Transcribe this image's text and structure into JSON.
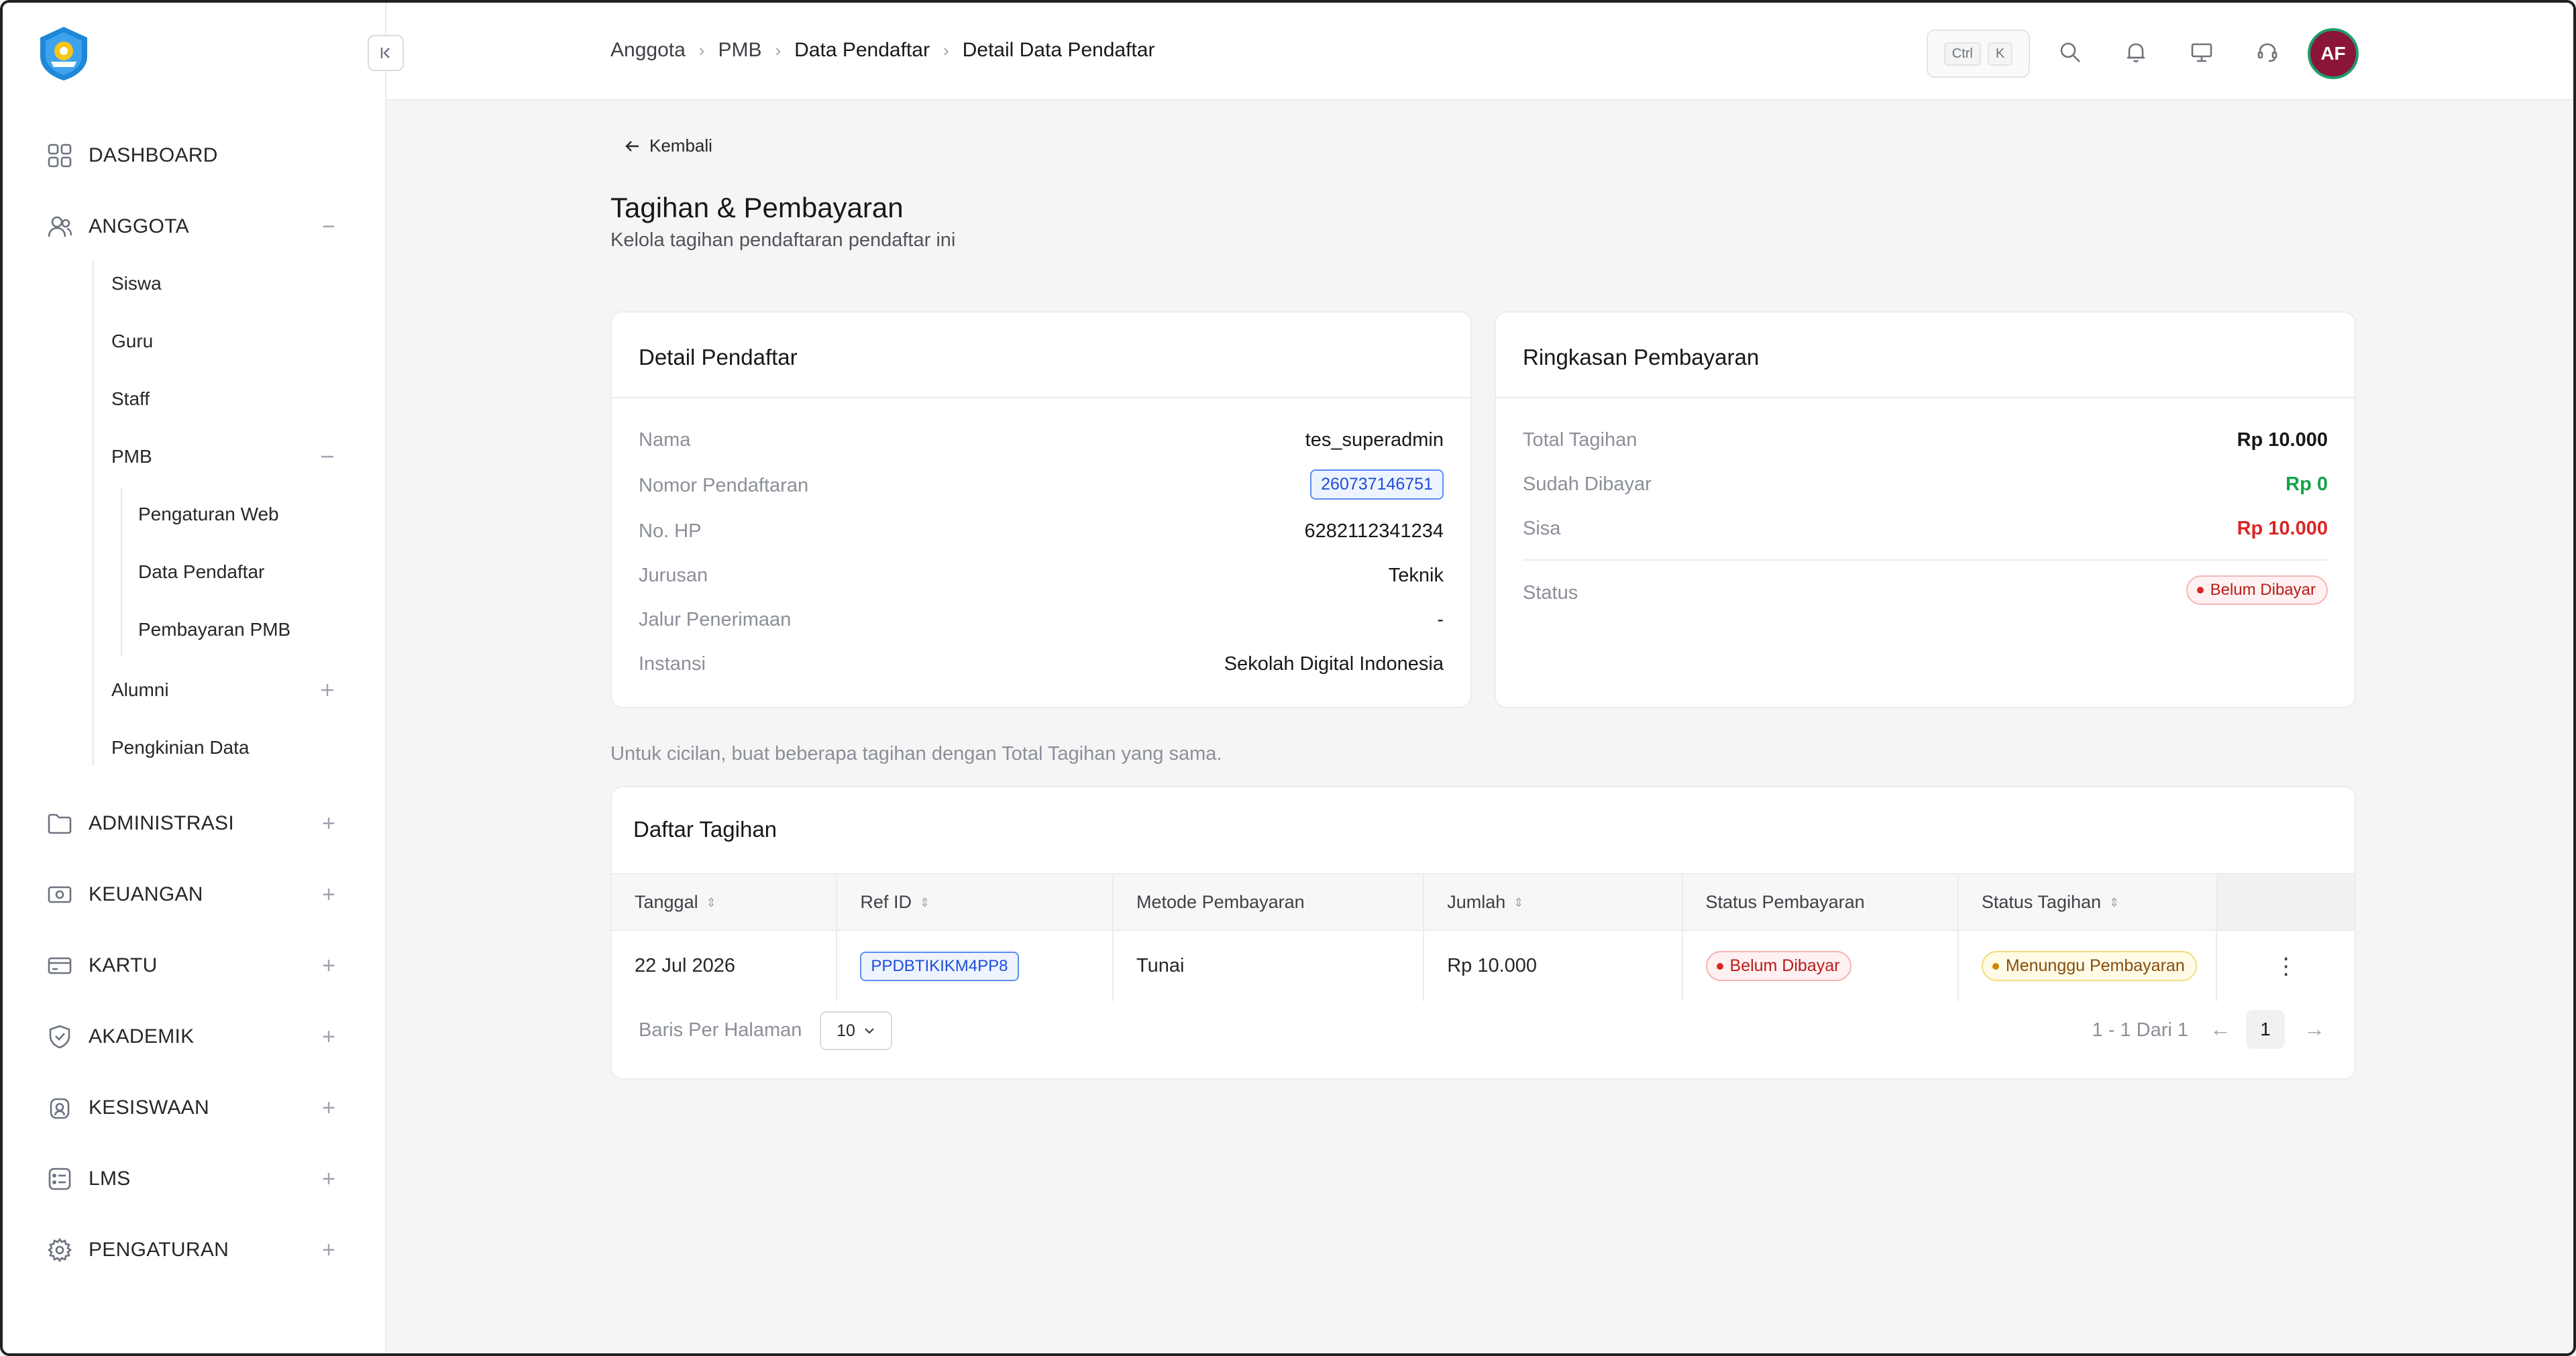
{
  "breadcrumb": [
    "Anggota",
    "PMB",
    "Data Pendaftar",
    "Detail Data Pendaftar"
  ],
  "search_kbd": {
    "ctrl": "Ctrl",
    "key": "K"
  },
  "user": {
    "initials": "AF",
    "avatar_color": "#8b1538"
  },
  "sidebar": {
    "items": [
      {
        "label": "DASHBOARD",
        "icon": "grid-icon"
      },
      {
        "label": "ANGGOTA",
        "icon": "users-icon",
        "toggle": "−"
      },
      {
        "label": "ADMINISTRASI",
        "icon": "folder-icon",
        "toggle": "+"
      },
      {
        "label": "KEUANGAN",
        "icon": "money-icon",
        "toggle": "+"
      },
      {
        "label": "KARTU",
        "icon": "card-icon",
        "toggle": "+"
      },
      {
        "label": "AKADEMIK",
        "icon": "shield-icon",
        "toggle": "+"
      },
      {
        "label": "KESISWAAN",
        "icon": "student-icon",
        "toggle": "+"
      },
      {
        "label": "LMS",
        "icon": "list-icon",
        "toggle": "+"
      },
      {
        "label": "PENGATURAN",
        "icon": "gear-icon",
        "toggle": "+"
      }
    ],
    "anggota_sub": [
      "Siswa",
      "Guru",
      "Staff",
      "PMB",
      "Alumni",
      "Pengkinian Data"
    ],
    "pmb_sub": [
      "Pengaturan Web",
      "Data Pendaftar",
      "Pembayaran PMB"
    ]
  },
  "page": {
    "back_label": "Kembali",
    "title": "Tagihan & Pembayaran",
    "subtitle": "Kelola tagihan pendaftaran pendaftar ini",
    "note": "Untuk cicilan, buat beberapa tagihan dengan Total Tagihan yang sama."
  },
  "detail": {
    "title": "Detail Pendaftar",
    "rows": [
      {
        "label": "Nama",
        "value": "tes_superadmin"
      },
      {
        "label": "Nomor Pendaftaran",
        "value": "260737146751"
      },
      {
        "label": "No. HP",
        "value": "6282112341234"
      },
      {
        "label": "Jurusan",
        "value": "Teknik"
      },
      {
        "label": "Jalur Penerimaan",
        "value": "-"
      },
      {
        "label": "Instansi",
        "value": "Sekolah Digital Indonesia"
      }
    ]
  },
  "summary": {
    "title": "Ringkasan Pembayaran",
    "total_label": "Total Tagihan",
    "total_value": "Rp 10.000",
    "paid_label": "Sudah Dibayar",
    "paid_value": "Rp 0",
    "rest_label": "Sisa",
    "rest_value": "Rp 10.000",
    "status_label": "Status",
    "status_value": "Belum Dibayar"
  },
  "bills": {
    "title": "Daftar Tagihan",
    "columns": [
      "Tanggal",
      "Ref ID",
      "Metode Pembayaran",
      "Jumlah",
      "Status Pembayaran",
      "Status Tagihan"
    ],
    "rows": [
      {
        "date": "22 Jul 2026",
        "ref": "PPDBTIKIKM4PP8",
        "method": "Tunai",
        "amount": "Rp 10.000",
        "pay_status": "Belum Dibayar",
        "bill_status": "Menunggu Pembayaran"
      }
    ],
    "per_page_label": "Baris Per Halaman",
    "per_page_value": "10",
    "page_info": "1 - 1 Dari 1",
    "current_page": "1",
    "prev": "←",
    "next": "→",
    "more": "⋮"
  },
  "colors": {
    "accent_blue": "#1d4ed8",
    "danger": "#dc2626",
    "success": "#16a34a",
    "warning": "#854d0e"
  }
}
